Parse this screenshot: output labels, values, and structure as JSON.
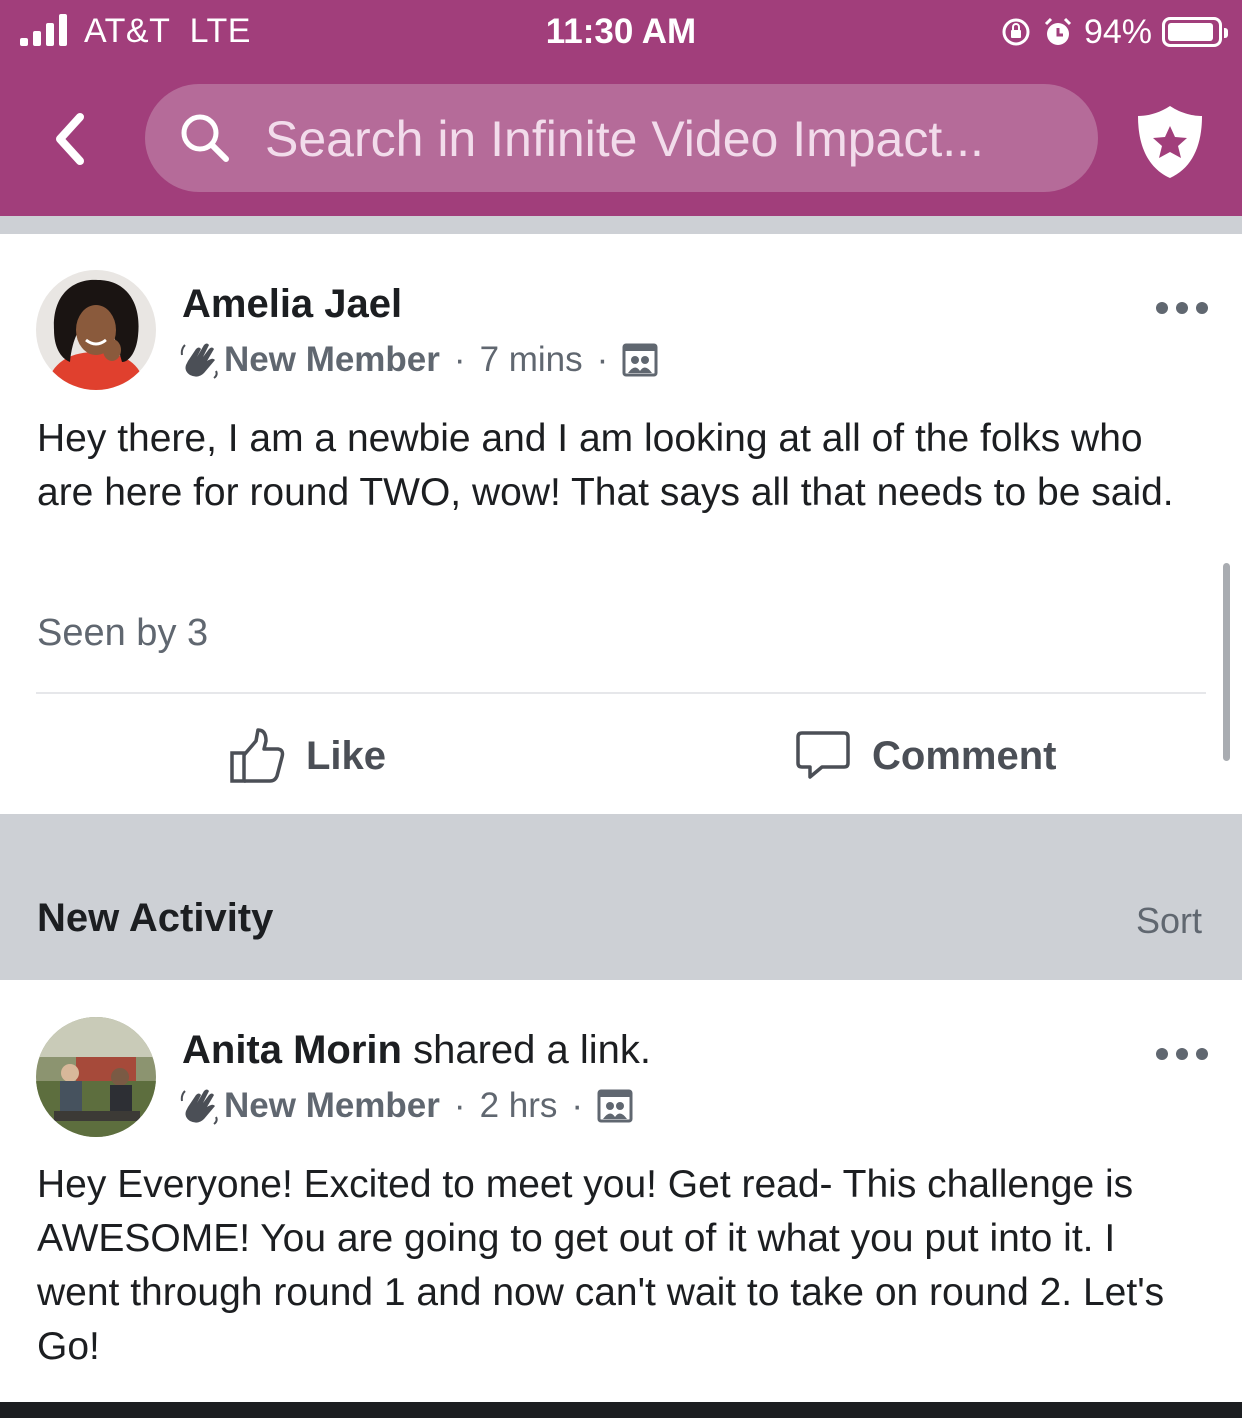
{
  "status_bar": {
    "carrier": "AT&T  LTE",
    "time": "11:30 AM",
    "battery": "94%",
    "battery_level": 0.94,
    "icons": [
      "signal-icon",
      "orientation-lock-icon",
      "alarm-icon",
      "battery-icon"
    ]
  },
  "nav": {
    "search_placeholder": "Search in Infinite Video Impact...",
    "icons": [
      "back-chevron-icon",
      "search-icon",
      "admin-shield-icon"
    ]
  },
  "colors": {
    "brand": "#a13e7b",
    "band": "#cdd0d5",
    "muted_text": "#606770"
  },
  "posts": [
    {
      "author": "Amelia Jael",
      "action": "",
      "badge": "New Member",
      "time": "7 mins",
      "text": "Hey there, I am a newbie and I am looking at all of the folks who are here for round TWO, wow!  That says all that needs to be said.",
      "seen": "Seen by 3",
      "like_label": "Like",
      "comment_label": "Comment"
    },
    {
      "author": "Anita Morin",
      "action": " shared a link.",
      "badge": "New Member",
      "time": "2 hrs",
      "text": "Hey Everyone! Excited to meet you! Get read- This challenge is AWESOME! You are going to get out of it what you put into it. I went through round 1 and now can't wait to take on round 2. Let's Go!"
    }
  ],
  "activity": {
    "title": "New Activity",
    "sort_label": "Sort"
  }
}
